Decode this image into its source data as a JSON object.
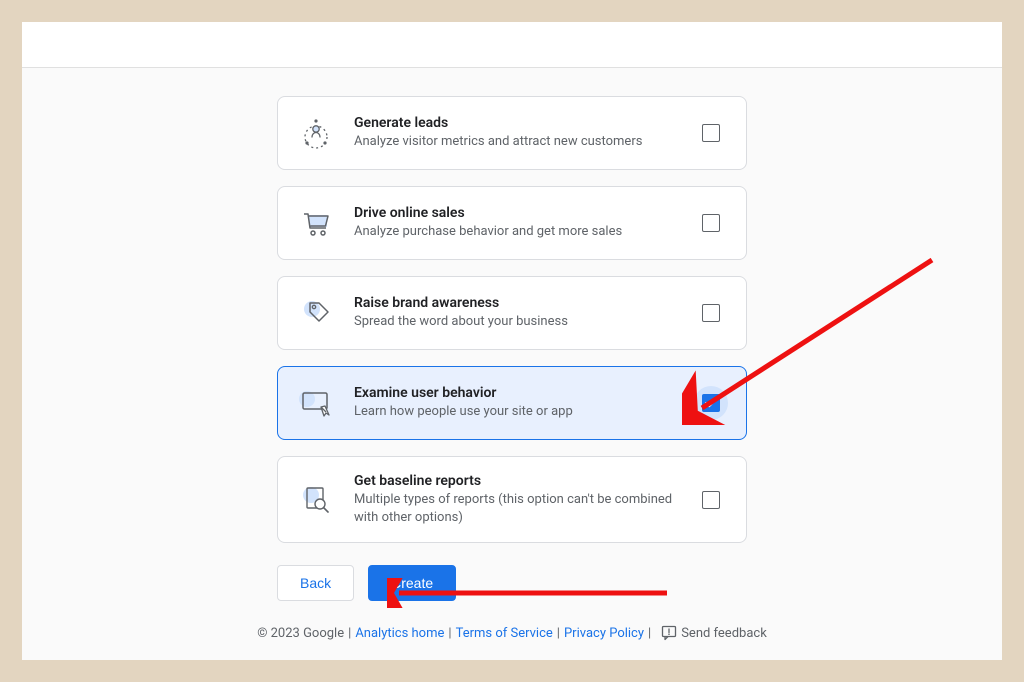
{
  "options": [
    {
      "title": "Generate leads",
      "desc": "Analyze visitor metrics and attract new customers",
      "selected": false
    },
    {
      "title": "Drive online sales",
      "desc": "Analyze purchase behavior and get more sales",
      "selected": false
    },
    {
      "title": "Raise brand awareness",
      "desc": "Spread the word about your business",
      "selected": false
    },
    {
      "title": "Examine user behavior",
      "desc": "Learn how people use your site or app",
      "selected": true
    },
    {
      "title": "Get baseline reports",
      "desc": "Multiple types of reports (this option can't be combined with other options)",
      "selected": false
    }
  ],
  "actions": {
    "back": "Back",
    "create": "Create"
  },
  "footer": {
    "copyright": "© 2023 Google",
    "analytics_home": "Analytics home",
    "terms": "Terms of Service",
    "privacy": "Privacy Policy",
    "feedback": "Send feedback"
  }
}
